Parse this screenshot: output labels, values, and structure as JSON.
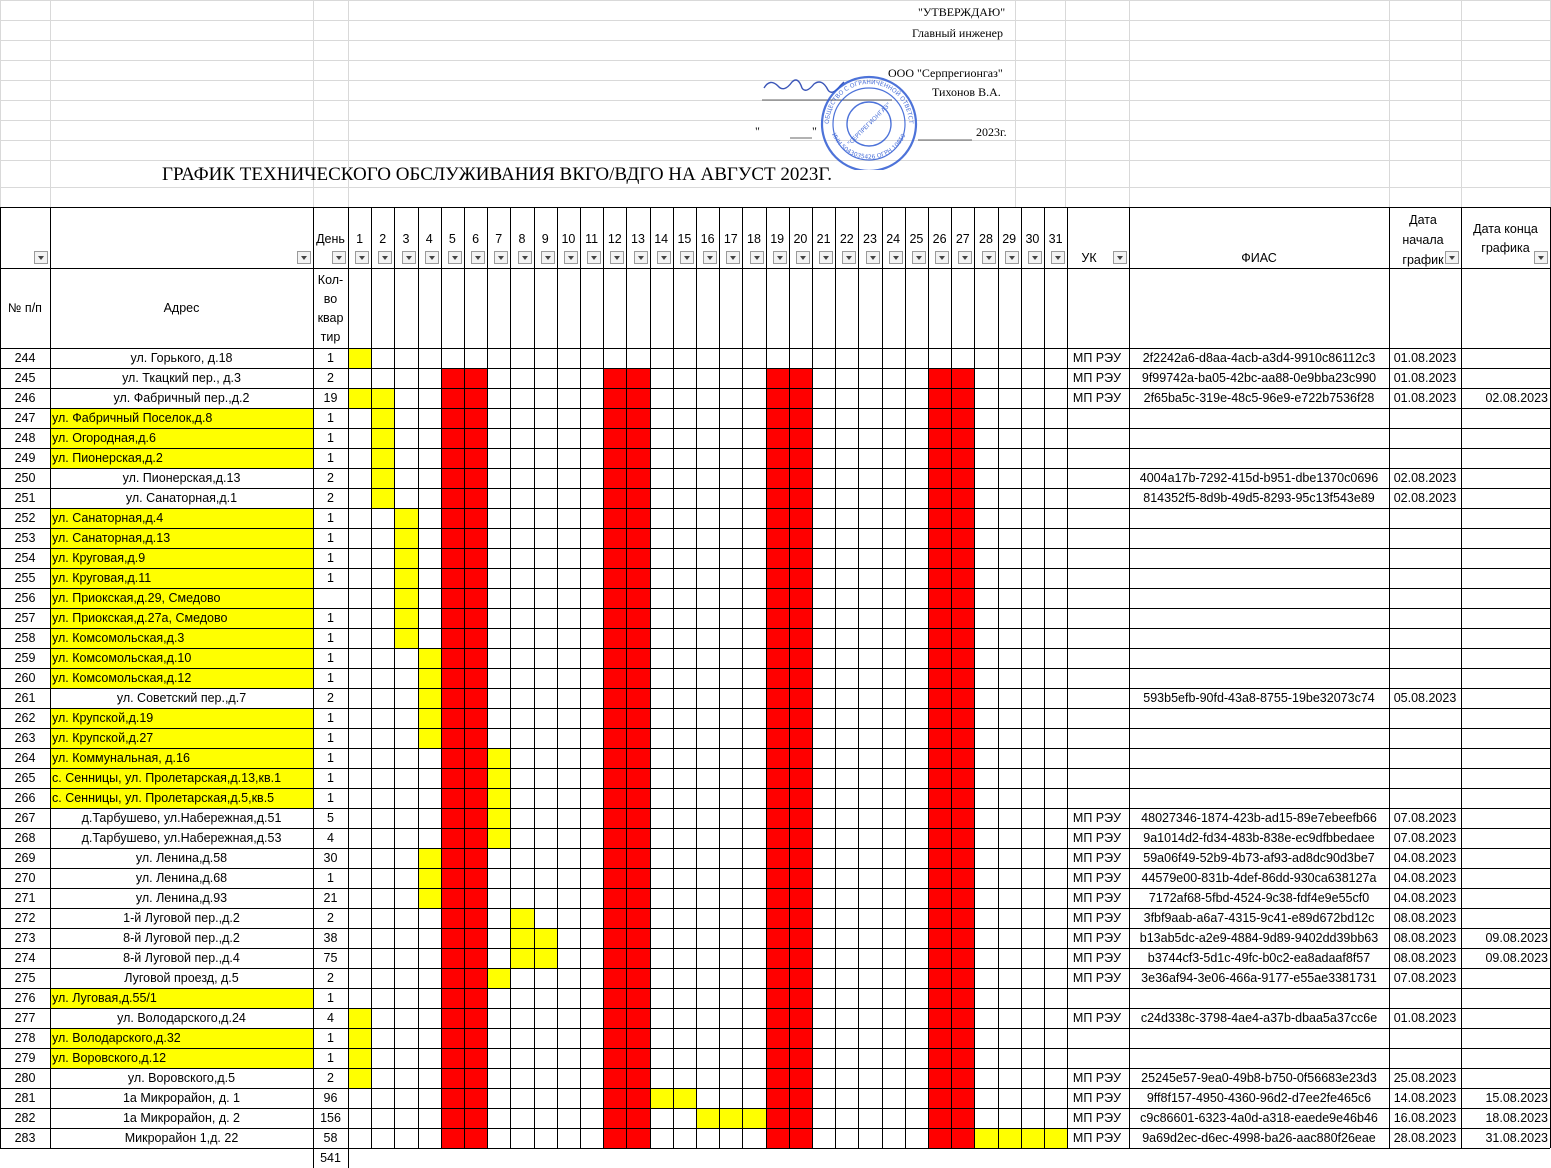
{
  "approval": {
    "approve": "\"УТВЕРЖДАЮ\"",
    "chief": "Главный инженер",
    "company": "ООО \"Серпрегионгаз\"",
    "name": "Тихонов В.А.",
    "date_open": "\"",
    "date_mid": "\"",
    "year": "2023г."
  },
  "stamp": {
    "center_text": "\"СЕРПРЕГИОНГАЗ\"",
    "ring_top": "ОБЩЕСТВО С ОГРАНИЧЕННОЙ ОТВЕТСТВЕННОСТЬЮ",
    "ring_bottom": "ИНН 5043035426 ОГРН 1085043002640"
  },
  "title": "ГРАФИК ТЕХНИЧЕСКОГО ОБСЛУЖИВАНИЯ ВКГО/ВДГО НА АВГУСТ 2023Г.",
  "header": {
    "num": "№ п/п",
    "address": "Адрес",
    "day": "День",
    "qty": "Кол-во квар тир",
    "qty_lines": [
      "Кол-",
      "во",
      "квар",
      "тир"
    ],
    "uk": "УК",
    "fias": "ФИАС",
    "date_start_lines": [
      "Дата",
      "начала",
      "график"
    ],
    "date_end_lines": [
      "Дата конца",
      "графика"
    ],
    "days": [
      "1",
      "2",
      "3",
      "4",
      "5",
      "6",
      "7",
      "8",
      "9",
      "10",
      "11",
      "12",
      "13",
      "14",
      "15",
      "16",
      "17",
      "18",
      "19",
      "20",
      "21",
      "22",
      "23",
      "24",
      "25",
      "26",
      "27",
      "28",
      "29",
      "30",
      "31"
    ]
  },
  "colors": {
    "yellow": "#ffff00",
    "red": "#ff0000",
    "grid": "#000000"
  },
  "weekend_days": [
    5,
    6,
    12,
    13,
    19,
    20,
    26,
    27
  ],
  "rows": [
    {
      "n": "244",
      "addr": "ул. Горького, д.18",
      "q": "1",
      "hl": false,
      "days": [
        1
      ],
      "uk": "МП РЭУ",
      "fias": "2f2242a6-d8aa-4acb-a3d4-9910c86112c3",
      "ds": "01.08.2023",
      "de": ""
    },
    {
      "n": "245",
      "addr": "ул. Ткацкий пер., д.3",
      "q": "2",
      "hl": false,
      "days": [],
      "uk": "МП РЭУ",
      "fias": "9f99742a-ba05-42bc-aa88-0e9bba23c990",
      "ds": "01.08.2023",
      "de": ""
    },
    {
      "n": "246",
      "addr": "ул. Фабричный пер.,д.2",
      "q": "19",
      "hl": false,
      "days": [
        1,
        2
      ],
      "uk": "МП РЭУ",
      "fias": "2f65ba5c-319e-48c5-96e9-e722b7536f28",
      "ds": "01.08.2023",
      "de": "02.08.2023"
    },
    {
      "n": "247",
      "addr": "ул. Фабричный Поселок,д.8",
      "q": "1",
      "hl": true,
      "days": [
        2
      ],
      "uk": "",
      "fias": "",
      "ds": "",
      "de": ""
    },
    {
      "n": "248",
      "addr": "ул. Огородная,д.6",
      "q": "1",
      "hl": true,
      "days": [
        2
      ],
      "uk": "",
      "fias": "",
      "ds": "",
      "de": ""
    },
    {
      "n": "249",
      "addr": "ул. Пионерская,д.2",
      "q": "1",
      "hl": true,
      "days": [
        2
      ],
      "uk": "",
      "fias": "",
      "ds": "",
      "de": ""
    },
    {
      "n": "250",
      "addr": "ул. Пионерская,д.13",
      "q": "2",
      "hl": false,
      "days": [
        2
      ],
      "uk": "",
      "fias": "4004a17b-7292-415d-b951-dbe1370c0696",
      "ds": "02.08.2023",
      "de": ""
    },
    {
      "n": "251",
      "addr": "ул. Санаторная,д.1",
      "q": "2",
      "hl": false,
      "days": [
        2
      ],
      "uk": "",
      "fias": "814352f5-8d9b-49d5-8293-95c13f543e89",
      "ds": "02.08.2023",
      "de": ""
    },
    {
      "n": "252",
      "addr": "ул. Санаторная,д.4",
      "q": "1",
      "hl": true,
      "days": [
        3
      ],
      "uk": "",
      "fias": "",
      "ds": "",
      "de": ""
    },
    {
      "n": "253",
      "addr": "ул. Санаторная,д.13",
      "q": "1",
      "hl": true,
      "days": [
        3
      ],
      "uk": "",
      "fias": "",
      "ds": "",
      "de": ""
    },
    {
      "n": "254",
      "addr": "ул. Круговая,д.9",
      "q": "1",
      "hl": true,
      "days": [
        3
      ],
      "uk": "",
      "fias": "",
      "ds": "",
      "de": ""
    },
    {
      "n": "255",
      "addr": "ул. Круговая,д.11",
      "q": "1",
      "hl": true,
      "days": [
        3
      ],
      "uk": "",
      "fias": "",
      "ds": "",
      "de": ""
    },
    {
      "n": "256",
      "addr": "ул. Приокская,д.29, Смедово",
      "q": "",
      "hl": true,
      "days": [
        3
      ],
      "uk": "",
      "fias": "",
      "ds": "",
      "de": ""
    },
    {
      "n": "257",
      "addr": "ул. Приокская,д.27а, Смедово",
      "q": "1",
      "hl": true,
      "days": [
        3
      ],
      "uk": "",
      "fias": "",
      "ds": "",
      "de": ""
    },
    {
      "n": "258",
      "addr": "ул. Комсомольская,д.3",
      "q": "1",
      "hl": true,
      "days": [
        3
      ],
      "uk": "",
      "fias": "",
      "ds": "",
      "de": ""
    },
    {
      "n": "259",
      "addr": "ул. Комсомольская,д.10",
      "q": "1",
      "hl": true,
      "days": [
        4
      ],
      "uk": "",
      "fias": "",
      "ds": "",
      "de": ""
    },
    {
      "n": "260",
      "addr": "ул. Комсомольская,д.12",
      "q": "1",
      "hl": true,
      "days": [
        4
      ],
      "uk": "",
      "fias": "",
      "ds": "",
      "de": ""
    },
    {
      "n": "261",
      "addr": "ул. Советский пер.,д.7",
      "q": "2",
      "hl": false,
      "days": [
        4
      ],
      "uk": "",
      "fias": "593b5efb-90fd-43a8-8755-19be32073c74",
      "ds": "05.08.2023",
      "de": ""
    },
    {
      "n": "262",
      "addr": "ул. Крупской,д.19",
      "q": "1",
      "hl": true,
      "days": [
        4
      ],
      "uk": "",
      "fias": "",
      "ds": "",
      "de": ""
    },
    {
      "n": "263",
      "addr": "ул. Крупской,д.27",
      "q": "1",
      "hl": true,
      "days": [
        4
      ],
      "uk": "",
      "fias": "",
      "ds": "",
      "de": ""
    },
    {
      "n": "264",
      "addr": "ул. Коммунальная, д.16",
      "q": "1",
      "hl": true,
      "days": [
        7
      ],
      "uk": "",
      "fias": "",
      "ds": "",
      "de": ""
    },
    {
      "n": "265",
      "addr": "с. Сенницы, ул. Пролетарская,д.13,кв.1",
      "q": "1",
      "hl": true,
      "days": [
        7
      ],
      "uk": "",
      "fias": "",
      "ds": "",
      "de": ""
    },
    {
      "n": "266",
      "addr": "с. Сенницы, ул. Пролетарская,д.5,кв.5",
      "q": "1",
      "hl": true,
      "days": [
        7
      ],
      "uk": "",
      "fias": "",
      "ds": "",
      "de": ""
    },
    {
      "n": "267",
      "addr": "д.Тарбушево, ул.Набережная,д.51",
      "q": "5",
      "hl": false,
      "days": [
        7
      ],
      "uk": "МП РЭУ",
      "fias": "48027346-1874-423b-ad15-89e7ebeefb66",
      "ds": "07.08.2023",
      "de": ""
    },
    {
      "n": "268",
      "addr": "д.Тарбушево, ул.Набережная,д.53",
      "q": "4",
      "hl": false,
      "days": [
        7
      ],
      "uk": "МП РЭУ",
      "fias": "9a1014d2-fd34-483b-838e-ec9dfbbedaee",
      "ds": "07.08.2023",
      "de": ""
    },
    {
      "n": "269",
      "addr": "ул. Ленина,д.58",
      "q": "30",
      "hl": false,
      "days": [
        4
      ],
      "uk": "МП РЭУ",
      "fias": "59a06f49-52b9-4b73-af93-ad8dc90d3be7",
      "ds": "04.08.2023",
      "de": ""
    },
    {
      "n": "270",
      "addr": "ул. Ленина,д.68",
      "q": "1",
      "hl": false,
      "days": [
        4
      ],
      "uk": "МП РЭУ",
      "fias": "44579e00-831b-4def-86dd-930ca638127a",
      "ds": "04.08.2023",
      "de": ""
    },
    {
      "n": "271",
      "addr": "ул. Ленина,д.93",
      "q": "21",
      "hl": false,
      "days": [
        4
      ],
      "uk": "МП РЭУ",
      "fias": "7172af68-5fbd-4524-9c38-fdf4e9e55cf0",
      "ds": "04.08.2023",
      "de": ""
    },
    {
      "n": "272",
      "addr": "1-й Луговой пер.,д.2",
      "q": "2",
      "hl": false,
      "days": [
        8
      ],
      "uk": "МП РЭУ",
      "fias": "3fbf9aab-a6a7-4315-9c41-e89d672bd12c",
      "ds": "08.08.2023",
      "de": ""
    },
    {
      "n": "273",
      "addr": "8-й Луговой пер.,д.2",
      "q": "38",
      "hl": false,
      "days": [
        8,
        9
      ],
      "uk": "МП РЭУ",
      "fias": "b13ab5dc-a2e9-4884-9d89-9402dd39bb63",
      "ds": "08.08.2023",
      "de": "09.08.2023"
    },
    {
      "n": "274",
      "addr": "8-й Луговой пер.,д.4",
      "q": "75",
      "hl": false,
      "days": [
        8,
        9
      ],
      "uk": "МП РЭУ",
      "fias": "b3744cf3-5d1c-49fc-b0c2-ea8adaaf8f57",
      "ds": "08.08.2023",
      "de": "09.08.2023"
    },
    {
      "n": "275",
      "addr": "Луговой проезд, д.5",
      "q": "2",
      "hl": false,
      "days": [
        7
      ],
      "uk": "МП РЭУ",
      "fias": "3e36af94-3e06-466a-9177-e55ae3381731",
      "ds": "07.08.2023",
      "de": ""
    },
    {
      "n": "276",
      "addr": "ул. Луговая,д.55/1",
      "q": "1",
      "hl": true,
      "days": [],
      "uk": "",
      "fias": "",
      "ds": "",
      "de": ""
    },
    {
      "n": "277",
      "addr": "ул. Володарского,д.24",
      "q": "4",
      "hl": false,
      "days": [
        1
      ],
      "uk": "МП РЭУ",
      "fias": "c24d338c-3798-4ae4-a37b-dbaa5a37cc6e",
      "ds": "01.08.2023",
      "de": ""
    },
    {
      "n": "278",
      "addr": "ул. Володарского,д.32",
      "q": "1",
      "hl": true,
      "days": [
        1
      ],
      "uk": "",
      "fias": "",
      "ds": "",
      "de": ""
    },
    {
      "n": "279",
      "addr": "ул. Воровского,д.12",
      "q": "1",
      "hl": true,
      "days": [
        1
      ],
      "uk": "",
      "fias": "",
      "ds": "",
      "de": ""
    },
    {
      "n": "280",
      "addr": "ул. Воровского,д.5",
      "q": "2",
      "hl": false,
      "days": [
        1
      ],
      "uk": "МП РЭУ",
      "fias": "25245e57-9ea0-49b8-b750-0f56683e23d3",
      "ds": "25.08.2023",
      "de": ""
    },
    {
      "n": "281",
      "addr": "1а Микрорайон, д. 1",
      "q": "96",
      "hl": false,
      "days": [
        14,
        15
      ],
      "uk": "МП РЭУ",
      "fias": "9ff8f157-4950-4360-96d2-d7ee2fe465c6",
      "ds": "14.08.2023",
      "de": "15.08.2023"
    },
    {
      "n": "282",
      "addr": "1а Микрорайон, д. 2",
      "q": "156",
      "hl": false,
      "days": [
        16,
        17,
        18
      ],
      "uk": "МП РЭУ",
      "fias": "c9c86601-6323-4a0d-a318-eaede9e46b46",
      "ds": "16.08.2023",
      "de": "18.08.2023"
    },
    {
      "n": "283",
      "addr": "Микрорайон 1,д. 22",
      "q": "58",
      "hl": false,
      "days": [
        28,
        29,
        30,
        31
      ],
      "uk": "МП РЭУ",
      "fias": "9a69d2ec-d6ec-4998-ba26-aac880f26eae",
      "ds": "28.08.2023",
      "de": "31.08.2023"
    }
  ],
  "total_qty": "541"
}
